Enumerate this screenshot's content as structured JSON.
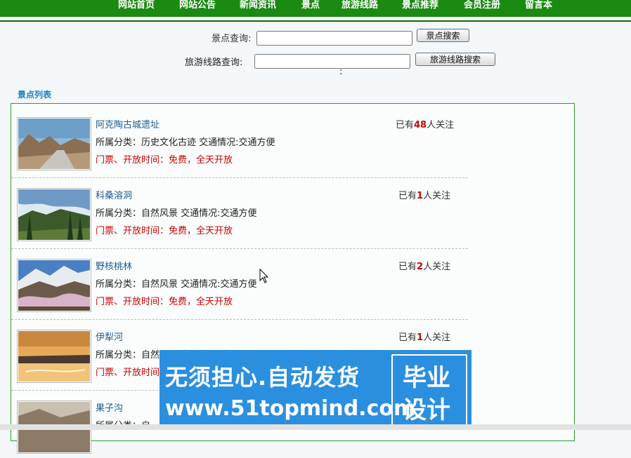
{
  "nav": {
    "items": [
      "网站首页",
      "网站公告",
      "新闻资讯",
      "景点",
      "旅游线路",
      "景点推荐",
      "会员注册",
      "留言本"
    ]
  },
  "search": {
    "scenic_label": "景点查询:",
    "scenic_value": "",
    "scenic_button": "景点搜索",
    "route_label": "旅游线路查询:",
    "route_value": "",
    "route_button": "旅游线路搜索",
    "colon": ":"
  },
  "list": {
    "title": "景点列表",
    "items": [
      {
        "name": "阿克陶古城遗址",
        "meta": "所属分类：历史文化古迹 交通情况:交通方便",
        "ticket": "门票、开放时间：免费，全天开放",
        "follow_prefix": "已有",
        "follow_count": "48",
        "follow_suffix": "人关注"
      },
      {
        "name": "科桑溶洞",
        "meta": "所属分类：自然风景 交通情况:交通方便",
        "ticket": "门票、开放时间：免费，全天开放",
        "follow_prefix": "已有",
        "follow_count": "1",
        "follow_suffix": "人关注"
      },
      {
        "name": "野核桃林",
        "meta": "所属分类：自然风景 交通情况:交通方便",
        "ticket": "门票、开放时间：免费，全天开放",
        "follow_prefix": "已有",
        "follow_count": "2",
        "follow_suffix": "人关注"
      },
      {
        "name": "伊犁河",
        "meta": "所属分类：自然风景 交通情况:交通方便",
        "ticket": "门票、开放时间：免费，全天开放",
        "follow_prefix": "已有",
        "follow_count": "1",
        "follow_suffix": "人关注"
      },
      {
        "name": "果子沟",
        "meta": "所属分类：自",
        "ticket": "",
        "follow_prefix": "",
        "follow_count": "",
        "follow_suffix": ""
      }
    ]
  },
  "watermark": {
    "line1": "无须担心.自动发货",
    "line2": "www.51topmind.com",
    "box_line1": "毕业",
    "box_line2": "设计"
  }
}
